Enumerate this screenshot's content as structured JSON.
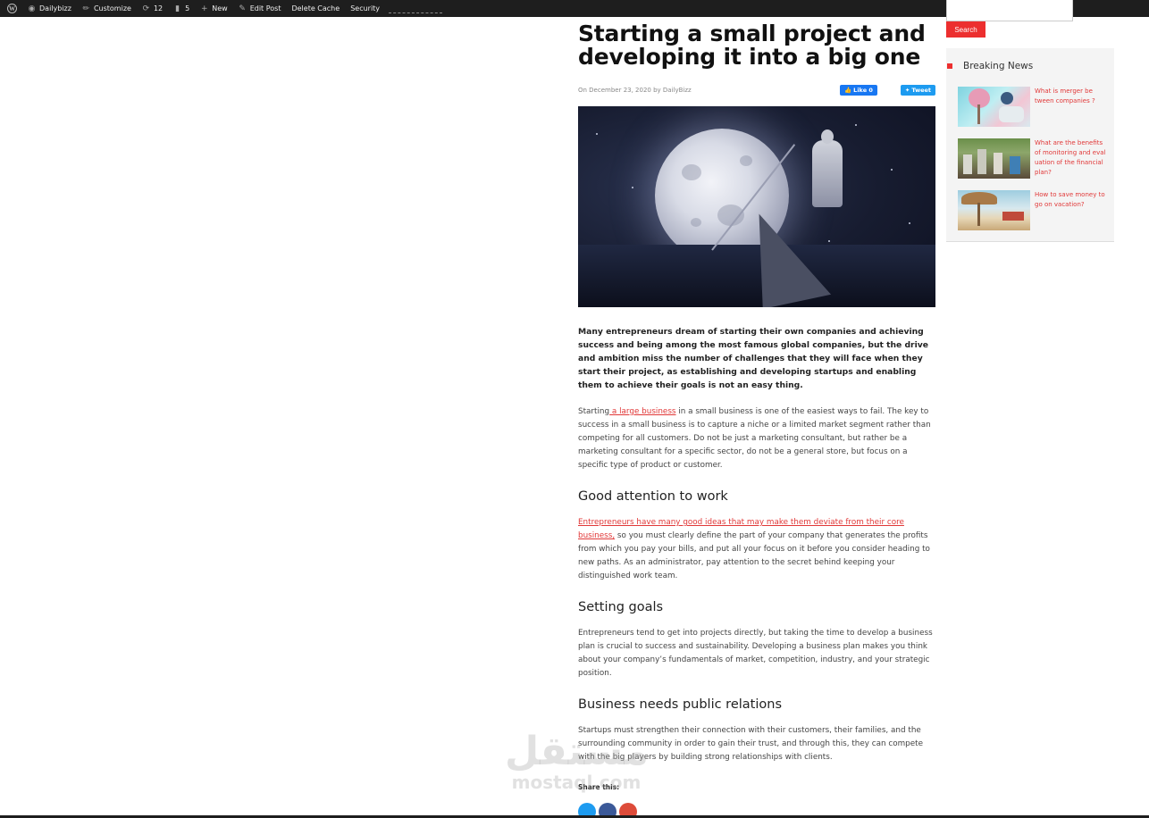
{
  "adminbar": {
    "site_name": "Dailybizz",
    "customize": "Customize",
    "updates_count": "12",
    "comments_count": "5",
    "new_label": "New",
    "edit_post": "Edit Post",
    "delete_cache": "Delete Cache",
    "security": "Security"
  },
  "post": {
    "title": "Starting a small project and developing it into a big one",
    "meta": "On December 23, 2020 by DailyBizz",
    "like_label": "Like 0",
    "tweet_label": "Tweet",
    "lead": "Many entrepreneurs dream of starting their own companies and achieving success and being among the most famous global companies, but the drive and ambition miss the number of challenges that they will face when they start their project, as establishing and developing startups and enabling them to achieve their goals is not an easy thing.",
    "p1_start": "Starting",
    "p1_link": " a large business",
    "p1_rest": " in a small business is one of the easiest ways to fail. The key to success in a small business is to capture a niche or a limited market segment rather than competing for all customers. Do not be just a marketing consultant, but rather be a marketing consultant for a specific sector, do not be a general store, but focus on a specific type of product or customer.",
    "h_attention": "Good attention to work",
    "p2_link": "Entrepreneurs have many good ideas that may make them deviate from their core business,",
    "p2_rest": " so you must clearly define the part of your company that generates the profits from which you pay your bills, and put all your focus on it before you consider heading to new paths. As an administrator, pay attention to the secret behind keeping your distinguished work team.",
    "h_goals": "Setting goals",
    "p3": "Entrepreneurs tend to get into projects directly, but taking the time to develop a business plan is crucial to success and sustainability. Developing a business plan makes you think about your company’s fundamentals of market, competition, industry, and your strategic position.",
    "h_pr": "Business needs public relations",
    "p4": "Startups must strengthen their connection with their customers, their families, and the surrounding community in order to gain their trust, and through this, they can compete with the big players by building strong relationships with clients.",
    "share_title": "Share this:"
  },
  "sidebar": {
    "search_label": "Search",
    "news_title": "Breaking News",
    "news": [
      {
        "title": "What is merger be tween companies ?"
      },
      {
        "title": "What are the benefits of monitoring and eval uation of the financial plan?"
      },
      {
        "title": "How to save money to go on vacation?"
      }
    ]
  },
  "watermark": {
    "arabic": "مستقل",
    "latin": "mostaql.com"
  },
  "colors": {
    "accent": "#ec2f2f",
    "link": "#e13838",
    "adminbar": "#1e1e1e"
  }
}
